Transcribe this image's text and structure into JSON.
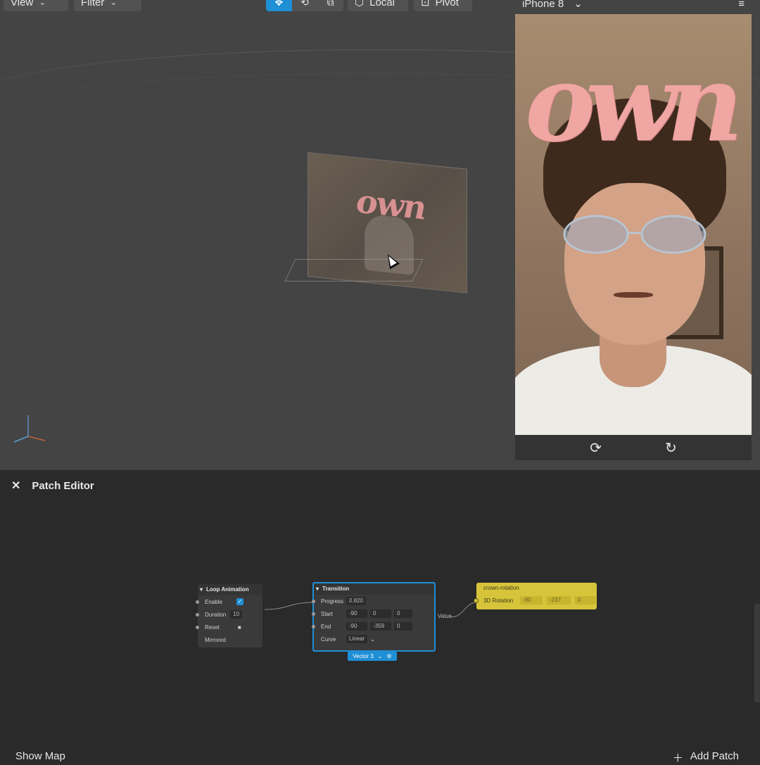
{
  "toolbar": {
    "view_label": "View",
    "filter_label": "Filter",
    "local_label": "Local",
    "pivot_label": "Pivot",
    "accent": "#1f8fd6"
  },
  "viewport": {
    "scene_word": "own"
  },
  "device": {
    "name": "iPhone 8",
    "overlay_word": "own",
    "menu_icon": "hamburger-icon",
    "switch_camera_icon": "switch-camera-icon",
    "rotate_icon": "rotate-device-icon"
  },
  "patch_editor": {
    "title": "Patch Editor",
    "show_map_label": "Show Map",
    "add_patch_label": "Add Patch",
    "loop_animation": {
      "title": "Loop Animation",
      "enable_label": "Enable",
      "duration_label": "Duration",
      "duration_value": "10",
      "reset_label": "Reset",
      "mirrored_label": "Mirrored"
    },
    "transition": {
      "title": "Transition",
      "progress_label": "Progress",
      "progress_value": "0.820",
      "start_label": "Start",
      "start_values": [
        "-90",
        "0",
        "0"
      ],
      "end_label": "End",
      "end_values": [
        "-90",
        "-359",
        "0"
      ],
      "curve_label": "Curve",
      "curve_value": "Linear",
      "output_label": "Value",
      "type_badge": "Vector 3"
    },
    "crown": {
      "title": "crown-rotation",
      "property_label": "3D Rotation",
      "values": [
        "-90",
        "-237",
        "0"
      ],
      "color": "#d6c43a"
    }
  }
}
